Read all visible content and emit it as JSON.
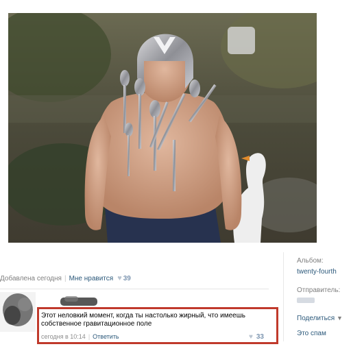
{
  "post": {
    "added_text": "Добавлена сегодня",
    "like_label": "Мне нравится",
    "like_count": "39"
  },
  "comment": {
    "text": "Этот неловкий момент, когда ты настолько жирный, что имеешь собственное гравитационное поле",
    "time": "сегодня в 10:14",
    "reply_label": "Ответить",
    "like_count": "33"
  },
  "sidebar": {
    "album_label": "Альбом:",
    "album_name": "twenty-fourth",
    "sender_label": "Отправитель:",
    "share_label": "Поделиться",
    "spam_label": "Это спам"
  },
  "icons": {
    "like": "heart-icon",
    "share_dropdown": "caret-down-icon"
  },
  "colors": {
    "link": "#2b587a",
    "highlight_border": "#c0392b",
    "muted": "#7f7f7f"
  }
}
